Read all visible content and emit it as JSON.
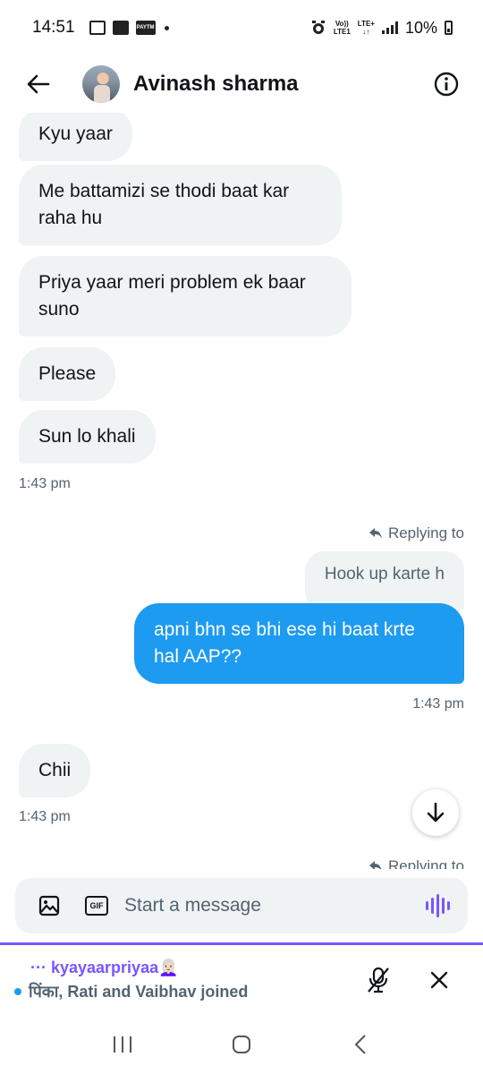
{
  "status_bar": {
    "time": "14:51",
    "paytm_label": "PAYTM",
    "volte_top": "Vo))",
    "volte_bottom": "LTE1",
    "lte_top": "LTE+",
    "lte_bottom": "↓↑",
    "battery": "10%"
  },
  "header": {
    "title": "Avinash sharma"
  },
  "messages": [
    {
      "id": "m1",
      "side": "in",
      "text": "Kyu yaar"
    },
    {
      "id": "m2",
      "side": "in",
      "text": "Me battamizi se thodi baat kar raha hu"
    },
    {
      "id": "m3",
      "side": "in",
      "text": "Priya yaar meri problem ek baar suno"
    },
    {
      "id": "m4",
      "side": "in",
      "text": "Please"
    },
    {
      "id": "m5",
      "side": "in",
      "text": "Sun lo khali"
    },
    {
      "id": "t1",
      "type": "timestamp",
      "text": "1:43 pm"
    },
    {
      "id": "r1",
      "type": "replying",
      "text": "Replying to"
    },
    {
      "id": "q1",
      "type": "quoted",
      "text": "Hook up karte h"
    },
    {
      "id": "m6",
      "side": "out",
      "text": "apni bhn se bhi ese hi baat krte hal AAP??"
    },
    {
      "id": "t2",
      "type": "timestamp",
      "text": "1:43 pm"
    },
    {
      "id": "m7",
      "side": "in",
      "text": "Chii"
    },
    {
      "id": "t3",
      "type": "timestamp",
      "text": "1:43 pm"
    },
    {
      "id": "r2",
      "type": "replying",
      "text": "Replying to"
    }
  ],
  "composer": {
    "gif_label": "GIF",
    "placeholder": "Start a message"
  },
  "space": {
    "title": "··· kyayaarpriyaa👩🏻‍🦳",
    "subtitle": "पिंका, Rati and Vaibhav joined"
  },
  "colors": {
    "accent": "#1d9bf0",
    "space_purple": "#7856ff",
    "bubble_in": "#eff3f4",
    "muted_text": "#536471"
  }
}
